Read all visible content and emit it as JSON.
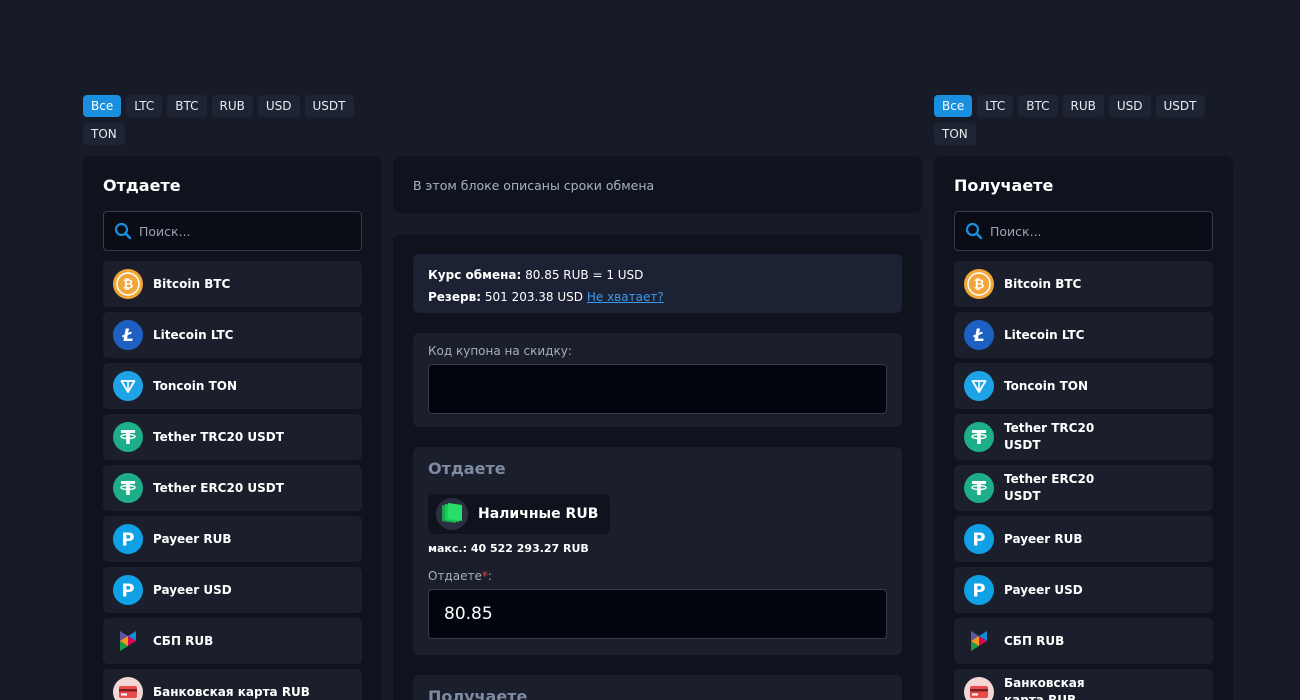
{
  "filters": [
    "Все",
    "LTC",
    "BTC",
    "RUB",
    "USD",
    "USDT",
    "TON"
  ],
  "give_panel": {
    "title": "Отдаете",
    "search_placeholder": "Поиск...",
    "items": [
      {
        "label": "Bitcoin BTC",
        "icon": "bitcoin-icon"
      },
      {
        "label": "Litecoin LTC",
        "icon": "litecoin-icon"
      },
      {
        "label": "Toncoin TON",
        "icon": "toncoin-icon"
      },
      {
        "label": "Tether TRC20 USDT",
        "icon": "tether-icon"
      },
      {
        "label": "Tether ERC20 USDT",
        "icon": "tether-icon"
      },
      {
        "label": "Payeer RUB",
        "icon": "payeer-icon"
      },
      {
        "label": "Payeer USD",
        "icon": "payeer-icon"
      },
      {
        "label": "СБП RUB",
        "icon": "sbp-icon"
      },
      {
        "label": "Банковская карта RUB",
        "icon": "bank-card-icon"
      }
    ]
  },
  "get_panel": {
    "title": "Получаете",
    "search_placeholder": "Поиск...",
    "items": [
      {
        "label": "Bitcoin BTC",
        "icon": "bitcoin-icon"
      },
      {
        "label": "Litecoin LTC",
        "icon": "litecoin-icon"
      },
      {
        "label": "Toncoin TON",
        "icon": "toncoin-icon"
      },
      {
        "label": "Tether TRC20 USDT",
        "icon": "tether-icon"
      },
      {
        "label": "Tether ERC20 USDT",
        "icon": "tether-icon"
      },
      {
        "label": "Payeer RUB",
        "icon": "payeer-icon"
      },
      {
        "label": "Payeer USD",
        "icon": "payeer-icon"
      },
      {
        "label": "СБП RUB",
        "icon": "sbp-icon"
      },
      {
        "label": "Банковская карта RUB",
        "icon": "bank-card-icon"
      }
    ]
  },
  "terms": {
    "text": "В этом блоке описаны сроки обмена"
  },
  "rate": {
    "rate_label": "Курс обмена:",
    "rate_value": "80.85 RUB = 1 USD",
    "reserve_label": "Резерв:",
    "reserve_value": "501 203.38 USD",
    "not_enough_link": "Не хватает?"
  },
  "coupon": {
    "label": "Код купона на скидку:",
    "value": ""
  },
  "give": {
    "title": "Отдаете",
    "currency": "Наличные RUB",
    "currency_icon": "cash-icon",
    "max_label": "макс.:",
    "max_value": "40 522 293.27 RUB",
    "amount_label": "Отдаете",
    "required_mark": "*",
    "amount_suffix": ":",
    "amount_value": "80.85"
  },
  "get": {
    "title": "Получаете"
  },
  "colors": {
    "background": "#161b27",
    "panel": "#0f131d",
    "accent": "#1a8fe0",
    "link": "#3a9cf0",
    "required": "#e04545"
  }
}
